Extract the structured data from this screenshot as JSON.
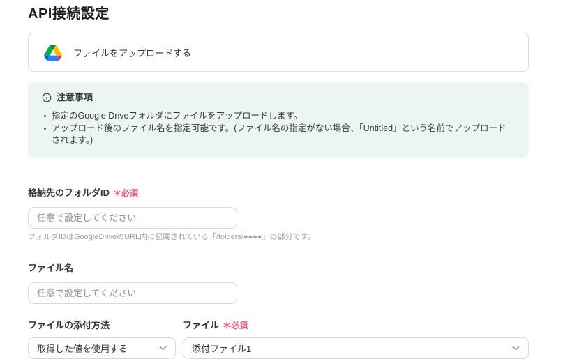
{
  "page": {
    "title": "API接続設定"
  },
  "action_card": {
    "icon": "google-drive-icon",
    "label": "ファイルをアップロードする"
  },
  "notice": {
    "icon": "info-circle-icon",
    "title": "注意事項",
    "bg_color": "#ebf5f1",
    "items": [
      "指定のGoogle Driveフォルダにファイルをアップロードします。",
      "アップロード後のファイル名を指定可能です。(ファイル名の指定がない場合、「Untitled」という名前でアップロードされます。)"
    ]
  },
  "form": {
    "required_mark": "＊必須",
    "required_color": "#f4546a",
    "folder_id": {
      "label": "格納先のフォルダID",
      "required": true,
      "value": "",
      "placeholder": "任意で設定してください",
      "helper": "フォルダIDはGoogleDriveのURL内に記載されている「/folders/●●●●」の部分です。"
    },
    "file_name": {
      "label": "ファイル名",
      "required": false,
      "value": "",
      "placeholder": "任意で設定してください"
    },
    "attach_method": {
      "label": "ファイルの添付方法",
      "required": false,
      "selected": "取得した値を使用する"
    },
    "file": {
      "label": "ファイル",
      "required": true,
      "selected": "添付ファイル1"
    }
  }
}
